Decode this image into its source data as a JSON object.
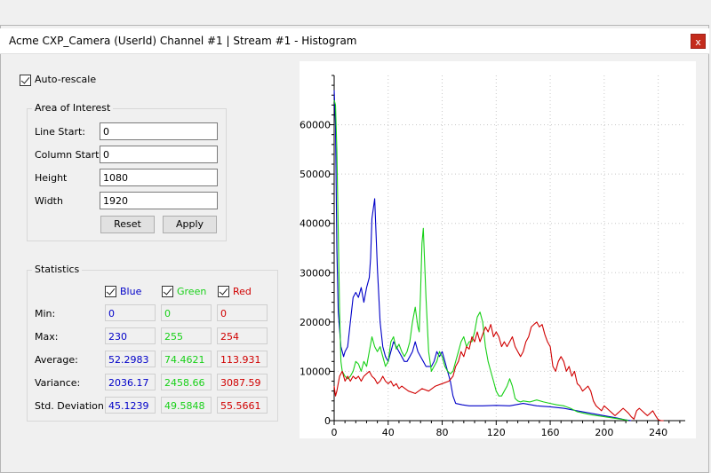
{
  "window": {
    "title": "Acme CXP_Camera (UserId) Channel #1 | Stream #1 - Histogram",
    "close_glyph": "x"
  },
  "auto_rescale": {
    "label": "Auto-rescale",
    "checked": true
  },
  "aoi": {
    "title": "Area of Interest",
    "fields": [
      {
        "label": "Line Start:",
        "value": "0"
      },
      {
        "label": "Column Start:",
        "value": "0"
      },
      {
        "label": "Height",
        "value": "1080"
      },
      {
        "label": "Width",
        "value": "1920"
      }
    ],
    "reset_label": "Reset",
    "apply_label": "Apply"
  },
  "stats": {
    "title": "Statistics",
    "channels": [
      {
        "name": "Blue",
        "color": "#0000c8",
        "checked": true
      },
      {
        "name": "Green",
        "color": "#18d018",
        "checked": true
      },
      {
        "name": "Red",
        "color": "#d00000",
        "checked": true
      }
    ],
    "rows": [
      {
        "label": "Min:",
        "values": [
          "0",
          "0",
          "0"
        ]
      },
      {
        "label": "Max:",
        "values": [
          "230",
          "255",
          "254"
        ]
      },
      {
        "label": "Average:",
        "values": [
          "52.2983",
          "74.4621",
          "113.931"
        ]
      },
      {
        "label": "Variance:",
        "values": [
          "2036.17",
          "2458.66",
          "3087.59"
        ]
      },
      {
        "label": "Std. Deviation:",
        "values": [
          "45.1239",
          "49.5848",
          "55.5661"
        ]
      }
    ]
  },
  "chart_data": {
    "type": "line",
    "xlim": [
      0,
      260
    ],
    "ylim": [
      0,
      70000
    ],
    "x_ticks": [
      0,
      40,
      80,
      120,
      160,
      200,
      240
    ],
    "y_ticks": [
      0,
      10000,
      20000,
      30000,
      40000,
      50000,
      60000
    ],
    "grid": true,
    "series": [
      {
        "color": "#0000c8",
        "x": [
          0,
          1,
          2,
          3,
          5,
          7,
          8,
          10,
          12,
          14,
          16,
          18,
          20,
          22,
          24,
          26,
          27,
          28,
          30,
          32,
          34,
          36,
          38,
          40,
          42,
          44,
          46,
          48,
          50,
          52,
          54,
          56,
          58,
          60,
          62,
          64,
          66,
          68,
          70,
          72,
          74,
          76,
          78,
          80,
          82,
          84,
          86,
          88,
          90,
          95,
          100,
          110,
          120,
          130,
          140,
          150,
          160,
          170,
          180,
          190,
          200,
          210,
          215,
          220
        ],
        "y": [
          67000,
          60000,
          35000,
          22000,
          15000,
          13000,
          14000,
          15000,
          20000,
          25000,
          26000,
          25000,
          27000,
          24000,
          27000,
          29000,
          33000,
          41000,
          45000,
          31000,
          20000,
          15000,
          13000,
          12000,
          14000,
          16000,
          15000,
          14000,
          13000,
          12000,
          12000,
          13000,
          14000,
          16000,
          14000,
          13000,
          12000,
          11000,
          11000,
          11000,
          12000,
          14000,
          13000,
          14000,
          12000,
          10000,
          8000,
          5000,
          3500,
          3200,
          3000,
          3000,
          3100,
          3000,
          3500,
          3000,
          2800,
          2500,
          2000,
          1500,
          1000,
          500,
          200,
          0
        ]
      },
      {
        "color": "#18d018",
        "x": [
          0,
          1,
          2,
          3,
          4,
          5,
          6,
          8,
          10,
          12,
          14,
          16,
          18,
          20,
          22,
          24,
          26,
          28,
          30,
          32,
          34,
          36,
          38,
          40,
          42,
          44,
          46,
          48,
          50,
          52,
          54,
          56,
          58,
          60,
          62,
          63,
          64,
          65,
          66,
          68,
          70,
          72,
          74,
          76,
          78,
          80,
          82,
          84,
          86,
          88,
          90,
          92,
          94,
          96,
          98,
          100,
          102,
          104,
          106,
          108,
          110,
          112,
          114,
          116,
          118,
          120,
          122,
          124,
          126,
          128,
          130,
          132,
          134,
          136,
          138,
          140,
          145,
          150,
          155,
          160,
          165,
          170,
          175,
          180,
          185,
          190,
          195,
          200,
          205,
          210,
          215,
          218
        ],
        "y": [
          65000,
          64000,
          55000,
          38000,
          22000,
          12000,
          10000,
          9000,
          8500,
          9000,
          10000,
          12000,
          11500,
          10000,
          12000,
          11000,
          14000,
          17000,
          15000,
          14000,
          15000,
          13000,
          11000,
          12000,
          16000,
          17000,
          14500,
          15500,
          14000,
          13000,
          14000,
          16000,
          20000,
          23000,
          19000,
          18000,
          26000,
          36000,
          39000,
          25000,
          14000,
          10000,
          11000,
          12000,
          14000,
          13000,
          11000,
          10000,
          9500,
          10000,
          12000,
          14000,
          16000,
          17000,
          15000,
          16000,
          16000,
          18000,
          21000,
          22000,
          20000,
          15000,
          12000,
          10000,
          8000,
          6000,
          5000,
          5000,
          6000,
          7000,
          8500,
          7000,
          4500,
          4000,
          3800,
          4000,
          3800,
          4200,
          3800,
          3500,
          3200,
          3000,
          2500,
          1800,
          1500,
          1200,
          1000,
          800,
          600,
          400,
          200,
          0
        ]
      },
      {
        "color": "#d00000",
        "x": [
          0,
          1,
          2,
          4,
          6,
          8,
          10,
          12,
          14,
          16,
          18,
          20,
          22,
          24,
          26,
          28,
          30,
          32,
          34,
          36,
          38,
          40,
          42,
          44,
          46,
          48,
          50,
          55,
          60,
          65,
          70,
          75,
          80,
          85,
          88,
          90,
          92,
          94,
          96,
          98,
          100,
          102,
          104,
          106,
          108,
          110,
          112,
          114,
          116,
          118,
          120,
          122,
          124,
          126,
          128,
          130,
          132,
          134,
          136,
          138,
          140,
          142,
          144,
          146,
          148,
          150,
          152,
          154,
          156,
          158,
          160,
          162,
          164,
          166,
          168,
          170,
          172,
          174,
          176,
          178,
          180,
          182,
          184,
          186,
          188,
          190,
          192,
          194,
          196,
          198,
          200,
          202,
          204,
          206,
          208,
          210,
          212,
          214,
          216,
          218,
          220,
          222,
          224,
          226,
          228,
          230,
          232,
          234,
          236,
          238,
          240,
          242,
          244
        ],
        "y": [
          7000,
          5000,
          6000,
          9000,
          10000,
          8000,
          9000,
          8000,
          9000,
          8500,
          9000,
          8000,
          9000,
          9500,
          10000,
          9000,
          8500,
          7500,
          8000,
          9000,
          8000,
          7500,
          8000,
          7000,
          7500,
          6500,
          7000,
          6000,
          5500,
          6500,
          6000,
          7000,
          7500,
          8000,
          9000,
          11000,
          12000,
          14000,
          13000,
          15000,
          14500,
          17000,
          16000,
          18000,
          16000,
          17500,
          19000,
          18000,
          19500,
          17000,
          18000,
          17000,
          15000,
          16000,
          15000,
          16000,
          17000,
          15000,
          14000,
          13000,
          14000,
          16000,
          17000,
          19000,
          19500,
          20000,
          19000,
          19500,
          17500,
          16000,
          15000,
          11000,
          10000,
          12000,
          13000,
          12000,
          10000,
          11000,
          9000,
          10000,
          7500,
          7000,
          6000,
          6500,
          7000,
          6000,
          4000,
          3000,
          2500,
          2000,
          3000,
          2500,
          2000,
          1500,
          1000,
          1500,
          2000,
          2500,
          2000,
          1500,
          800,
          300,
          2000,
          2500,
          2000,
          1500,
          1000,
          1500,
          2000,
          1000,
          200,
          0,
          0
        ]
      }
    ]
  }
}
